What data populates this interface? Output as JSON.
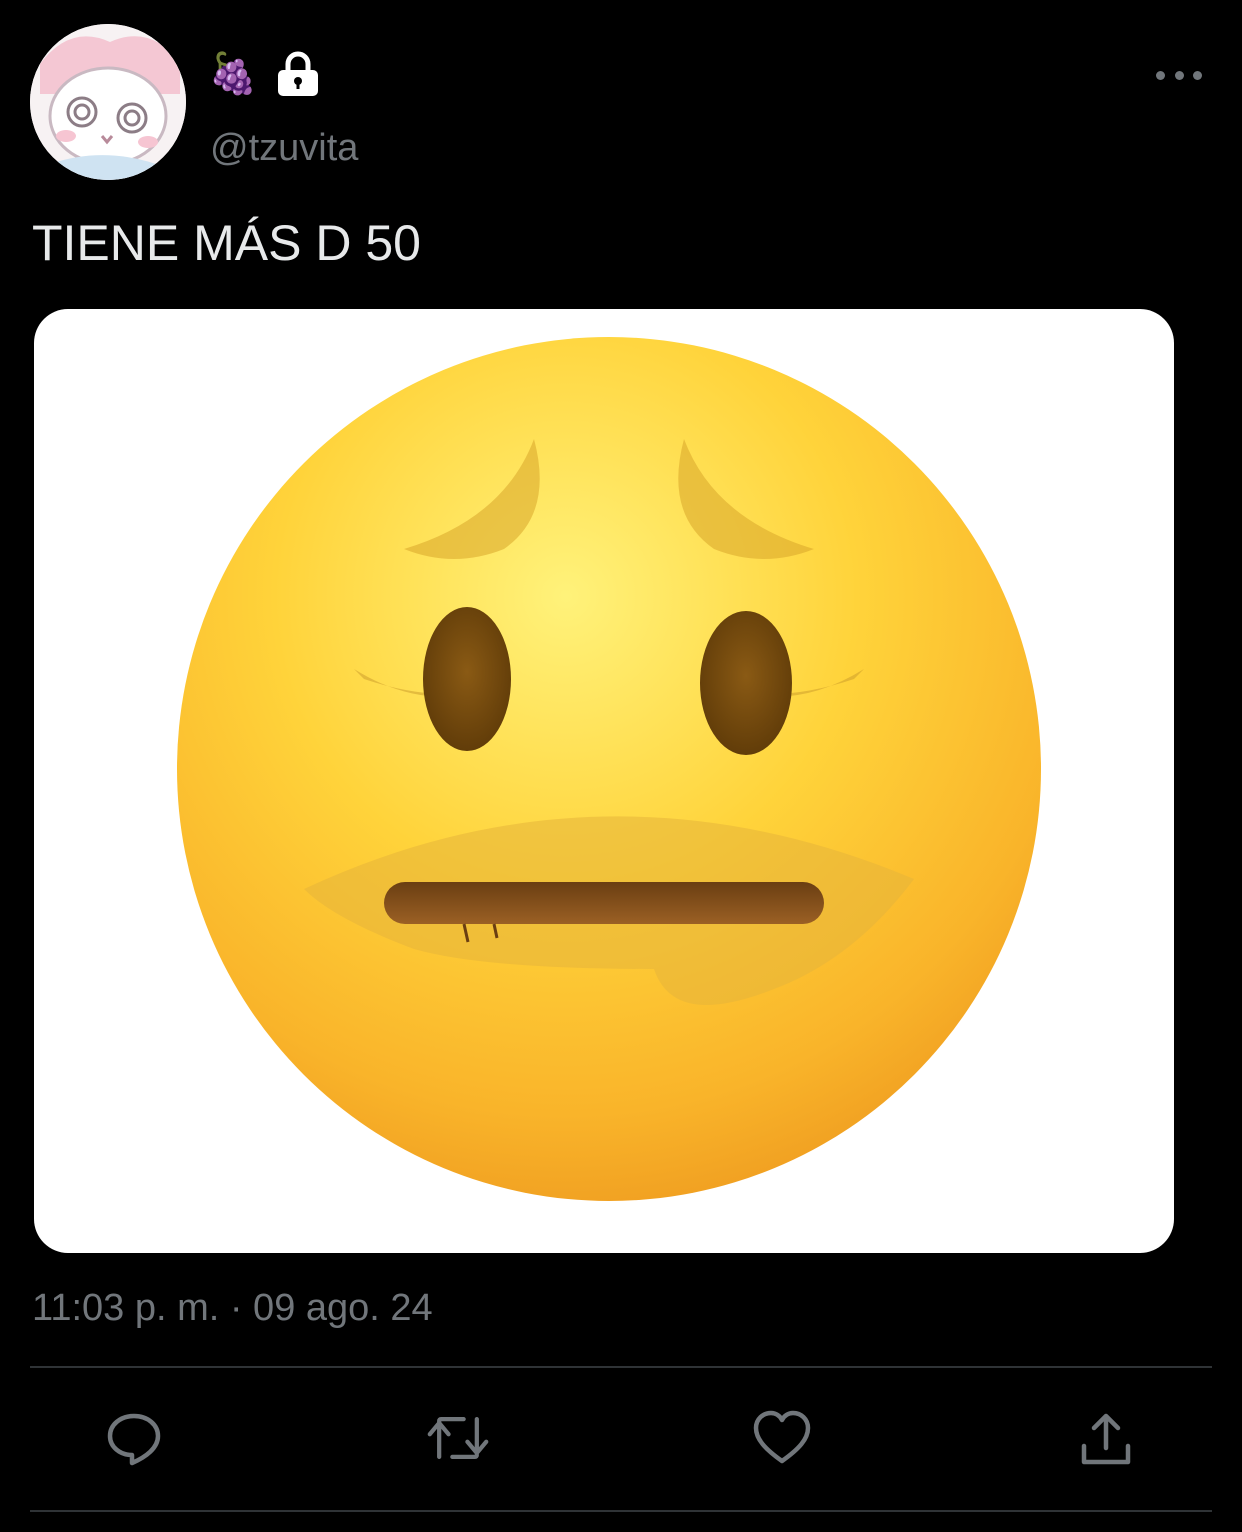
{
  "author": {
    "name_emoji": "🍇",
    "handle": "@tzuvita",
    "protected_icon": "lock-icon",
    "avatar_icon": "cartoon-avatar-icon"
  },
  "tweet": {
    "text": "TIENE MÁS D 50",
    "media_icon": "sad-lip-biting-face-emoji",
    "timestamp": "11:03 p. m. · 09 ago. 24"
  },
  "toolbar": {
    "more_icon": "more-dots-icon",
    "reply_icon": "reply-icon",
    "retweet_icon": "retweet-icon",
    "like_icon": "heart-icon",
    "share_icon": "share-icon"
  },
  "colors": {
    "background": "#000000",
    "text": "#e7e9ea",
    "secondary": "#71767b",
    "divider": "#2f3336"
  }
}
